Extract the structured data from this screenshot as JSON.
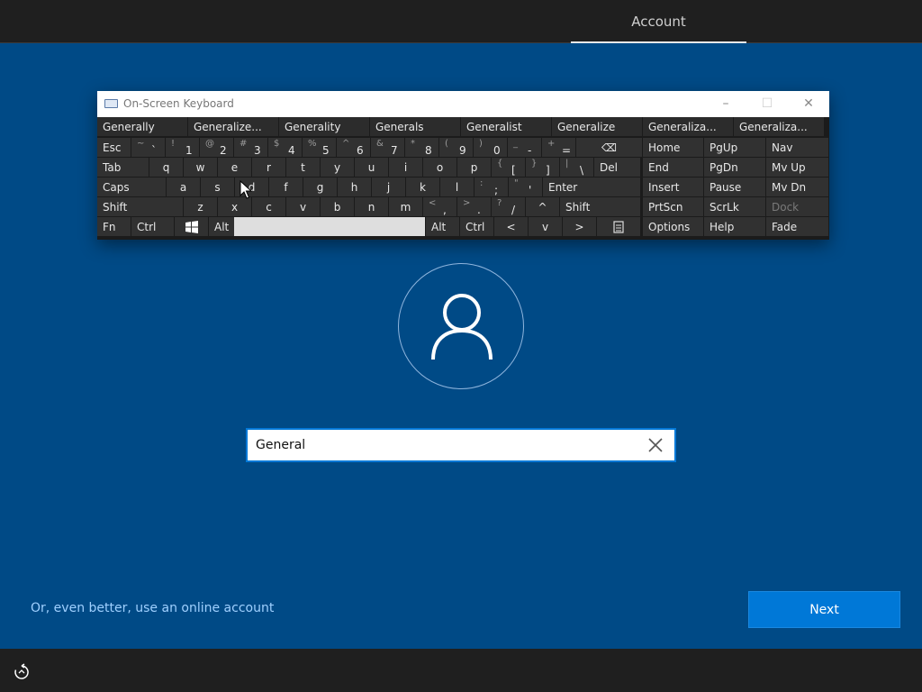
{
  "header": {
    "tab": "Account"
  },
  "osk": {
    "title": "On-Screen Keyboard",
    "window_buttons": {
      "minimize": "–",
      "maximize": "☐",
      "close": "✕"
    },
    "predictions": [
      "Generally",
      "Generalize...",
      "Generality",
      "Generals",
      "Generalist",
      "Generalize",
      "Generaliza...",
      "Generaliza..."
    ],
    "row1": [
      {
        "label": "Esc"
      },
      {
        "sup": "~",
        "main": "`"
      },
      {
        "sup": "!",
        "main": "1"
      },
      {
        "sup": "@",
        "main": "2"
      },
      {
        "sup": "#",
        "main": "3"
      },
      {
        "sup": "$",
        "main": "4"
      },
      {
        "sup": "%",
        "main": "5"
      },
      {
        "sup": "^",
        "main": "6"
      },
      {
        "sup": "&",
        "main": "7"
      },
      {
        "sup": "*",
        "main": "8"
      },
      {
        "sup": "(",
        "main": "9"
      },
      {
        "sup": ")",
        "main": "0"
      },
      {
        "sup": "_",
        "main": "-"
      },
      {
        "sup": "+",
        "main": "="
      },
      {
        "label": "⌫"
      }
    ],
    "row2": [
      "Tab",
      "q",
      "w",
      "e",
      "r",
      "t",
      "y",
      "u",
      "i",
      "o",
      "p"
    ],
    "row2_brackets": [
      {
        "sup": "{",
        "main": "["
      },
      {
        "sup": "}",
        "main": "]"
      },
      {
        "sup": "|",
        "main": "\\"
      }
    ],
    "row2_del": "Del",
    "row3": [
      "Caps",
      "a",
      "s",
      "d",
      "f",
      "g",
      "h",
      "j",
      "k",
      "l"
    ],
    "row3_punct": [
      {
        "sup": ":",
        "main": ";"
      },
      {
        "sup": "\"",
        "main": "'"
      }
    ],
    "row3_enter": "Enter",
    "row4": [
      "Shift",
      "z",
      "x",
      "c",
      "v",
      "b",
      "n",
      "m"
    ],
    "row4_punct": [
      {
        "sup": "<",
        "main": ","
      },
      {
        "sup": ">",
        "main": "."
      },
      {
        "sup": "?",
        "main": "/"
      }
    ],
    "row4_up": "^",
    "row4_shift": "Shift",
    "row5": {
      "fn": "Fn",
      "ctrl": "Ctrl",
      "alt": "Alt",
      "alt2": "Alt",
      "ctrl2": "Ctrl",
      "left": "<",
      "down": "v",
      "right": ">"
    },
    "nav_keys": [
      [
        "Home",
        "PgUp",
        "Nav"
      ],
      [
        "End",
        "PgDn",
        "Mv Up"
      ],
      [
        "Insert",
        "Pause",
        "Mv Dn"
      ],
      [
        "PrtScn",
        "ScrLk",
        "Dock"
      ],
      [
        "Options",
        "Help",
        "Fade"
      ]
    ]
  },
  "name_input": {
    "value": "General"
  },
  "links": {
    "online_account": "Or, even better, use an online account"
  },
  "buttons": {
    "next": "Next"
  }
}
